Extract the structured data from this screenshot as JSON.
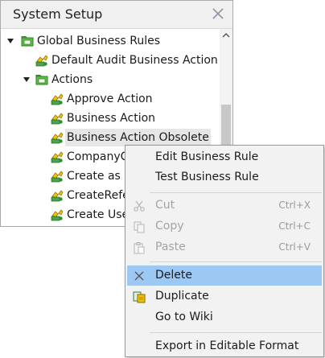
{
  "panel": {
    "title": "System Setup",
    "close_icon": "close-icon"
  },
  "tree": {
    "items": [
      {
        "label": "Global Business Rules",
        "icon": "folder-icon",
        "expanded": true
      },
      {
        "label": "Default Audit Business Action",
        "icon": "business-action-icon"
      },
      {
        "label": "Actions",
        "icon": "folder-icon",
        "expanded": true
      },
      {
        "label": "Approve Action",
        "icon": "business-action-icon"
      },
      {
        "label": "Business Action",
        "icon": "business-action-icon"
      },
      {
        "label": "Business Action Obsolete",
        "icon": "business-action-icon",
        "selected": true
      },
      {
        "label": "CompanyCo",
        "icon": "business-action-icon"
      },
      {
        "label": "Create as Se",
        "icon": "business-action-icon"
      },
      {
        "label": "CreateRefer",
        "icon": "business-action-icon"
      },
      {
        "label": "Create User",
        "icon": "business-action-icon"
      }
    ]
  },
  "context_menu": {
    "items": [
      {
        "label": "Edit Business Rule",
        "shortcut": "",
        "enabled": true
      },
      {
        "label": "Test Business Rule",
        "shortcut": "",
        "enabled": true
      },
      {
        "label": "Cut",
        "shortcut": "Ctrl+X",
        "enabled": false,
        "icon": "scissors-icon"
      },
      {
        "label": "Copy",
        "shortcut": "Ctrl+C",
        "enabled": false,
        "icon": "copy-icon"
      },
      {
        "label": "Paste",
        "shortcut": "Ctrl+V",
        "enabled": false,
        "icon": "paste-icon"
      },
      {
        "label": "Delete",
        "shortcut": "",
        "enabled": true,
        "highlighted": true,
        "icon": "delete-icon"
      },
      {
        "label": "Duplicate",
        "shortcut": "",
        "enabled": true,
        "icon": "duplicate-icon"
      },
      {
        "label": "Go to Wiki",
        "shortcut": "",
        "enabled": true
      },
      {
        "label": "Export in Editable Format",
        "shortcut": "",
        "enabled": true
      }
    ]
  },
  "colors": {
    "highlight": "#9ec8f4",
    "folder_green": "#3aa23a",
    "action_yellow": "#f3c000"
  }
}
